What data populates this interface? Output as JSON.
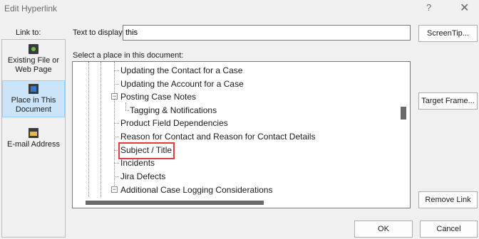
{
  "window": {
    "title": "Edit Hyperlink",
    "help_label": "?",
    "close_label": "✕"
  },
  "link_to": {
    "label": "Link to:",
    "items": [
      {
        "label": "Existing File or Web Page",
        "icon": "existing-file-icon",
        "selected": false
      },
      {
        "label": "Place in This Document",
        "icon": "place-in-document-icon",
        "selected": true
      },
      {
        "label": "E-mail Address",
        "icon": "email-address-icon",
        "selected": false
      }
    ]
  },
  "text_to_display": {
    "label": "Text to display:",
    "value": "this"
  },
  "select_place_label": "Select a place in this document:",
  "tree_items": [
    "Updating the Contact for a Case",
    "Updating the Account for a Case",
    "Posting Case Notes",
    "Tagging & Notifications",
    "Product Field Dependencies",
    "Reason for Contact and Reason for Contact Details",
    "Subject / Title",
    "Incidents",
    "Jira Defects",
    "Additional Case Logging Considerations"
  ],
  "expander_symbol": "⊟",
  "buttons": {
    "screentip": "ScreenTip...",
    "target_frame": "Target Frame...",
    "remove_link": "Remove Link",
    "ok": "OK",
    "cancel": "Cancel"
  },
  "colors": {
    "highlight_border": "#e23c3c",
    "selected_bg": "#cce4f7"
  }
}
